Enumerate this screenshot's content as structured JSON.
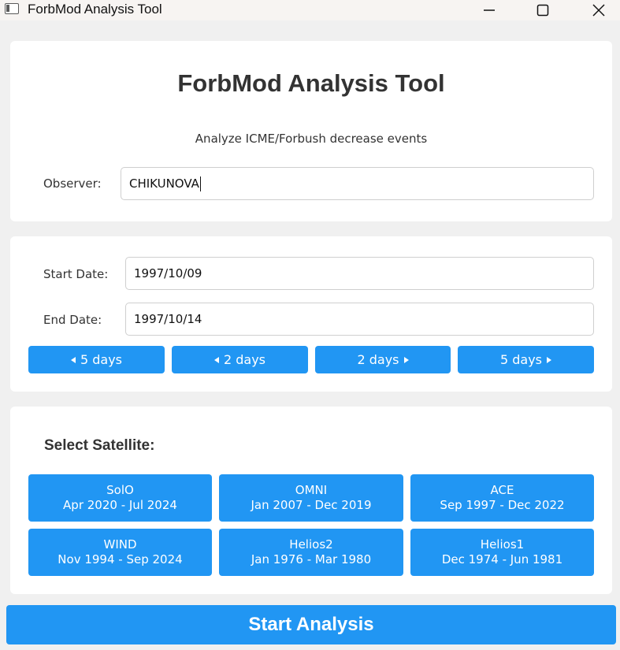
{
  "window": {
    "title": "ForbMod Analysis Tool"
  },
  "header": {
    "title": "ForbMod Analysis Tool",
    "subtitle": "Analyze ICME/Forbush decrease events"
  },
  "observer": {
    "label": "Observer:",
    "value": "CHIKUNOVA"
  },
  "dates": {
    "start_label": "Start Date:",
    "start_value": "1997/10/09",
    "end_label": "End Date:",
    "end_value": "1997/10/14",
    "buttons": [
      "5 days",
      "2 days",
      "2 days",
      "5 days"
    ]
  },
  "satellites": {
    "label": "Select Satellite:",
    "items": [
      {
        "name": "SolO",
        "range": "Apr 2020 - Jul 2024"
      },
      {
        "name": "OMNI",
        "range": "Jan 2007 - Dec 2019"
      },
      {
        "name": "ACE",
        "range": "Sep 1997 - Dec 2022"
      },
      {
        "name": "WIND",
        "range": "Nov 1994 - Sep 2024"
      },
      {
        "name": "Helios2",
        "range": "Jan 1976 - Mar 1980"
      },
      {
        "name": "Helios1",
        "range": "Dec 1974 - Jun 1981"
      }
    ]
  },
  "actions": {
    "start_label": "Start Analysis"
  },
  "colors": {
    "accent": "#2196f3",
    "background": "#f0f0f0",
    "card": "#ffffff"
  }
}
